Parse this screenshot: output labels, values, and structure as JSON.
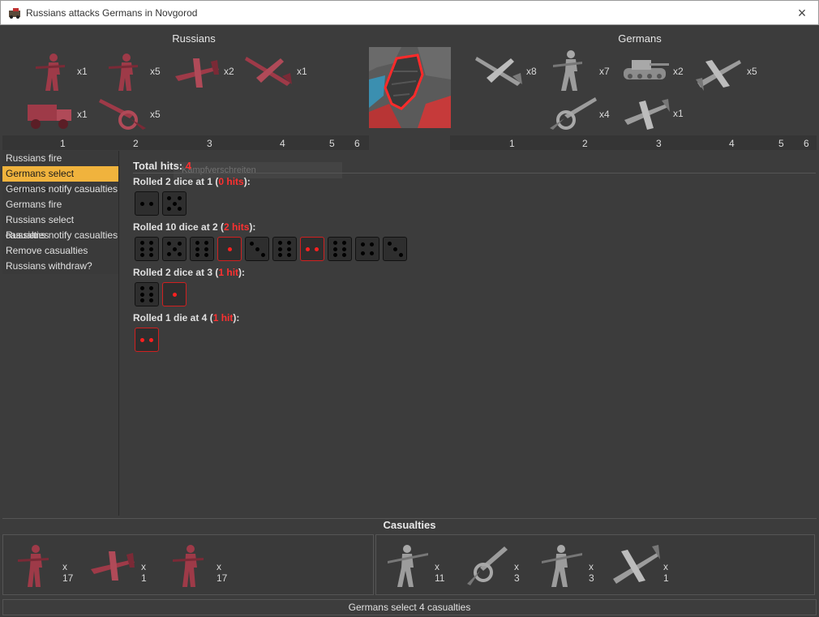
{
  "window": {
    "title": "Russians attacks Germans in Novgorod",
    "close_glyph": "×",
    "app_icon": "triplea-icon"
  },
  "russians": {
    "title": "Russians",
    "color": "#9e3a48",
    "units": [
      {
        "name": "infantry",
        "count": "x1"
      },
      {
        "name": "infantry",
        "count": "x5"
      },
      {
        "name": "fighter",
        "count": "x2"
      },
      {
        "name": "bomber",
        "count": "x1"
      },
      {
        "name": "truck",
        "count": "x1"
      },
      {
        "name": "artillery",
        "count": "x5"
      }
    ],
    "column_numbers": [
      "1",
      "2",
      "3",
      "4",
      "5",
      "6"
    ]
  },
  "germans": {
    "title": "Germans",
    "color": "#9c9c9c",
    "units": [
      {
        "name": "bomber",
        "count": "x8"
      },
      {
        "name": "infantry",
        "count": "x7"
      },
      {
        "name": "tank",
        "count": "x2"
      },
      {
        "name": "fighter",
        "count": "x5"
      },
      {
        "name": "artillery",
        "count": "x4"
      },
      {
        "name": "dive-bomber",
        "count": "x1"
      }
    ],
    "column_numbers": [
      "1",
      "2",
      "3",
      "4",
      "5",
      "6"
    ]
  },
  "steps": [
    "Russians fire",
    "Germans select casualties",
    "Germans notify casualties",
    "Germans fire",
    "Russians select casualties",
    "Russians notify casualties",
    "Remove casualties",
    "Russians withdraw?"
  ],
  "active_step_index": 1,
  "results": {
    "total_label": "Total hits: ",
    "total_value": "4",
    "ghost_text": "Kampfverschreiten",
    "rolls": [
      {
        "prefix": "Rolled 2 dice at 1 (",
        "hits": "0 hits",
        "suffix": "):",
        "dice": [
          2,
          5
        ],
        "hit": [
          false,
          false
        ]
      },
      {
        "prefix": "Rolled 10 dice at 2 (",
        "hits": "2 hits",
        "suffix": "):",
        "dice": [
          6,
          5,
          6,
          1,
          3,
          6,
          2,
          6,
          4,
          3
        ],
        "hit": [
          false,
          false,
          false,
          true,
          false,
          false,
          true,
          false,
          false,
          false
        ]
      },
      {
        "prefix": "Rolled 2 dice at 3 (",
        "hits": "1 hit",
        "suffix": "):",
        "dice": [
          6,
          1
        ],
        "hit": [
          false,
          true
        ]
      },
      {
        "prefix": "Rolled 1 die at 4 (",
        "hits": "1 hit",
        "suffix": "):",
        "dice": [
          2
        ],
        "hit": [
          true
        ]
      }
    ]
  },
  "casualties": {
    "title": "Casualties",
    "russians": [
      {
        "name": "infantry",
        "count": "x 17"
      },
      {
        "name": "fighter",
        "count": "x 1"
      },
      {
        "name": "infantry",
        "count": "x 17"
      }
    ],
    "germans": [
      {
        "name": "infantry",
        "count": "x 11"
      },
      {
        "name": "artillery",
        "count": "x 3"
      },
      {
        "name": "infantry",
        "count": "x 3"
      },
      {
        "name": "bomber",
        "count": "x 1"
      }
    ]
  },
  "status": "Germans select 4 casualties"
}
